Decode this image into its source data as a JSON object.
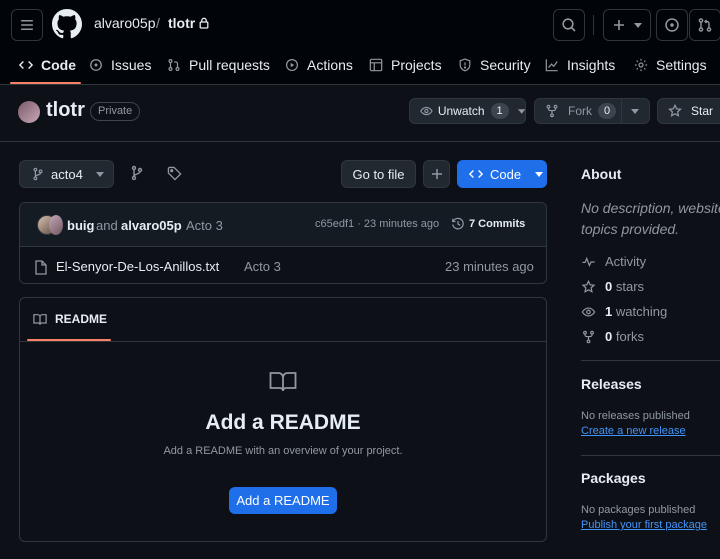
{
  "header": {
    "owner": "alvaro05p",
    "separator": "/",
    "repo": "tlotr"
  },
  "nav": {
    "tabs": [
      {
        "label": "Code",
        "icon": "code-icon"
      },
      {
        "label": "Issues",
        "icon": "issue-icon"
      },
      {
        "label": "Pull requests",
        "icon": "pull-request-icon"
      },
      {
        "label": "Actions",
        "icon": "play-icon"
      },
      {
        "label": "Projects",
        "icon": "table-icon"
      },
      {
        "label": "Security",
        "icon": "shield-icon"
      },
      {
        "label": "Insights",
        "icon": "graph-icon"
      },
      {
        "label": "Settings",
        "icon": "gear-icon"
      }
    ]
  },
  "repo_header": {
    "name": "tlotr",
    "visibility": "Private",
    "unwatch_label": "Unwatch",
    "watch_count": "1",
    "fork_label": "Fork",
    "fork_count": "0",
    "star_label": "Star"
  },
  "toolbar": {
    "branch": "acto4",
    "go_to_file": "Go to file",
    "code_button": "Code"
  },
  "commit": {
    "author1": "buig",
    "conjunction": "and",
    "author2": "alvaro05p",
    "message": "Acto 3",
    "hash_time": "c65edf1 · 23 minutes ago",
    "commits": "7 Commits"
  },
  "files": [
    {
      "name": "El-Senyor-De-Los-Anillos.txt",
      "message": "Acto 3",
      "time": "23 minutes ago"
    }
  ],
  "readme": {
    "tab": "README",
    "title": "Add a README",
    "description": "Add a README with an overview of your project.",
    "button": "Add a README"
  },
  "sidebar": {
    "about_title": "About",
    "about_text_1": "No description, website",
    "about_text_2": "topics provided.",
    "activity": "Activity",
    "stars_count": "0",
    "stars_label": "stars",
    "watching_count": "1",
    "watching_label": "watching",
    "forks_count": "0",
    "forks_label": "forks",
    "releases_title": "Releases",
    "releases_none": "No releases published",
    "releases_link": "Create a new release",
    "packages_title": "Packages",
    "packages_none": "No packages published",
    "packages_link": "Publish your first package"
  },
  "colors": {
    "background": "#0d1117",
    "header_bg": "#010409",
    "border": "#30363d",
    "accent_blue": "#1f6feb",
    "link": "#4493f8",
    "tab_underline": "#f78166"
  }
}
